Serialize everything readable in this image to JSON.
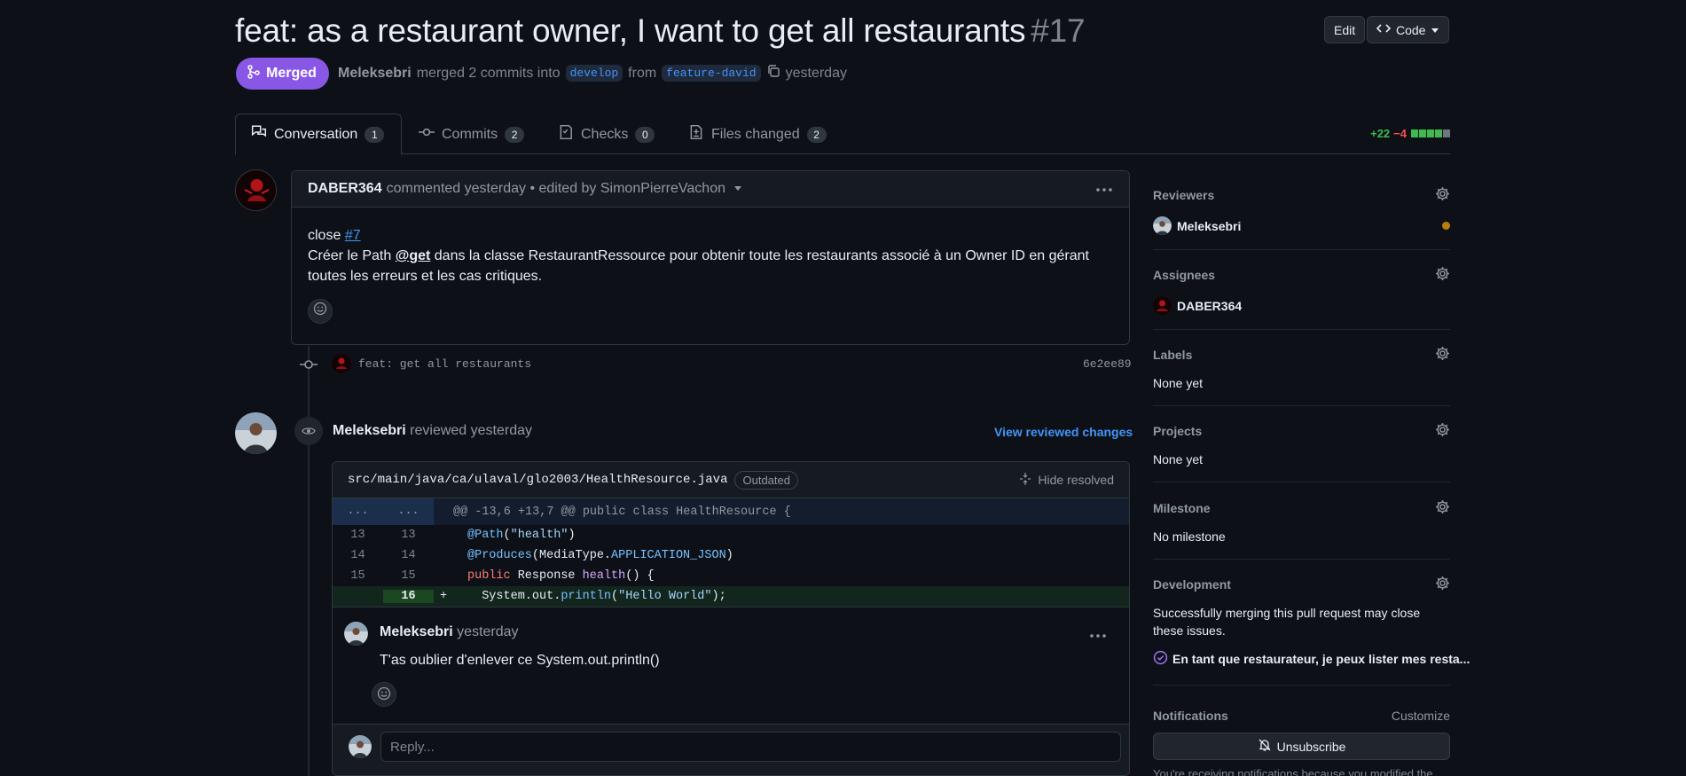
{
  "header": {
    "title": "feat: as a restaurant owner, I want to get all restaurants",
    "number": "#17",
    "edit_label": "Edit",
    "code_label": "Code"
  },
  "status": {
    "badge": "Merged",
    "author": "Meleksebri",
    "action": "merged 2 commits into",
    "base_branch": "develop",
    "from_word": "from",
    "head_branch": "feature-david",
    "when": "yesterday"
  },
  "tabs": [
    {
      "label": "Conversation",
      "count": "1"
    },
    {
      "label": "Commits",
      "count": "2"
    },
    {
      "label": "Checks",
      "count": "0"
    },
    {
      "label": "Files changed",
      "count": "2"
    }
  ],
  "diffstat": {
    "additions": "+22",
    "deletions": "−4"
  },
  "comment": {
    "author": "DABER364",
    "meta": "commented yesterday • edited by SimonPierreVachon",
    "line1_prefix": "close",
    "line1_link": "#7",
    "line2_prefix": "Créer le Path",
    "line2_mention": "@get",
    "line2_rest": "dans la classe RestaurantRessource pour obtenir toute les restaurants associé à un Owner ID en gérant toutes les erreurs et les cas critiques."
  },
  "commit": {
    "message": "feat: get all restaurants",
    "sha": "6e2ee89"
  },
  "review": {
    "author": "Meleksebri",
    "meta": "reviewed yesterday",
    "view_changes": "View reviewed changes",
    "file_path": "src/main/java/ca/ulaval/glo2003/HealthResource.java",
    "outdated": "Outdated",
    "hide_resolved": "Hide resolved",
    "hunk_left": "...",
    "hunk_right": "...",
    "hunk_header": "@@ -13,6 +13,7 @@ public class HealthResource {",
    "lines": [
      {
        "old": "13",
        "new": "13"
      },
      {
        "old": "14",
        "new": "14"
      },
      {
        "old": "15",
        "new": "15"
      },
      {
        "old": "",
        "new": "16",
        "sign": "+"
      }
    ],
    "code": {
      "l1_a": "@Path",
      "l1_b": "(",
      "l1_c": "\"health\"",
      "l1_d": ")",
      "l2_a": "@Produces",
      "l2_b": "(MediaType.",
      "l2_c": "APPLICATION_JSON",
      "l2_d": ")",
      "l3_a": "public",
      "l3_b": " Response ",
      "l3_c": "health",
      "l3_d": "() {",
      "l4_a": "  System.out.",
      "l4_b": "println",
      "l4_c": "(",
      "l4_d": "\"Hello World\"",
      "l4_e": ");"
    },
    "reply_comment": {
      "author": "Meleksebri",
      "when": "yesterday",
      "text": "T'as oublier d'enlever ce System.out.println()"
    },
    "reply_placeholder": "Reply..."
  },
  "sidebar": {
    "reviewers": {
      "title": "Reviewers",
      "name": "Meleksebri"
    },
    "assignees": {
      "title": "Assignees",
      "name": "DABER364"
    },
    "labels": {
      "title": "Labels",
      "value": "None yet"
    },
    "projects": {
      "title": "Projects",
      "value": "None yet"
    },
    "milestone": {
      "title": "Milestone",
      "value": "No milestone"
    },
    "development": {
      "title": "Development",
      "text": "Successfully merging this pull request may close these issues.",
      "issue": "En tant que restaurateur, je peux lister mes resta..."
    },
    "notifications": {
      "title": "Notifications",
      "customize": "Customize",
      "unsubscribe": "Unsubscribe",
      "footer": "You're receiving notifications because you modified the"
    }
  },
  "colors": {
    "merged": "#8957e5",
    "link": "#4493f8",
    "add": "#3fb950",
    "del": "#f85149",
    "pending": "#bb8009"
  }
}
